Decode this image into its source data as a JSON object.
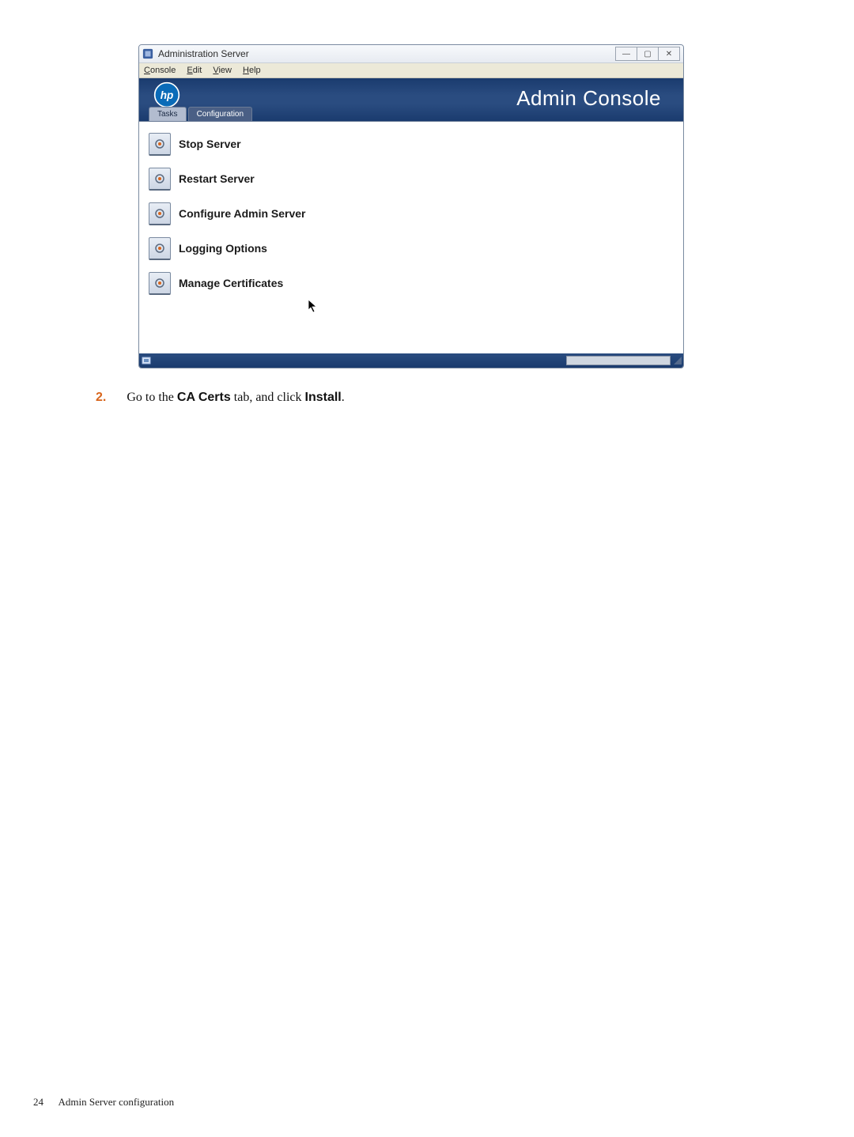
{
  "window": {
    "title": "Administration Server",
    "controls": {
      "min": "—",
      "max": "▢",
      "close": "✕"
    }
  },
  "menubar": {
    "console": "Console",
    "edit": "Edit",
    "view": "View",
    "help": "Help"
  },
  "header": {
    "title": "Admin Console",
    "tabs": [
      {
        "label": "Tasks",
        "active": false
      },
      {
        "label": "Configuration",
        "active": true
      }
    ]
  },
  "tasks": [
    {
      "label": "Stop Server"
    },
    {
      "label": "Restart Server"
    },
    {
      "label": "Configure Admin Server"
    },
    {
      "label": "Logging Options"
    },
    {
      "label": "Manage Certificates"
    }
  ],
  "step": {
    "number": "2.",
    "pre": "Go to the ",
    "bold1": "CA Certs",
    "mid": " tab, and click ",
    "bold2": "Install",
    "post": "."
  },
  "footer": {
    "page": "24",
    "section": "Admin Server configuration"
  }
}
